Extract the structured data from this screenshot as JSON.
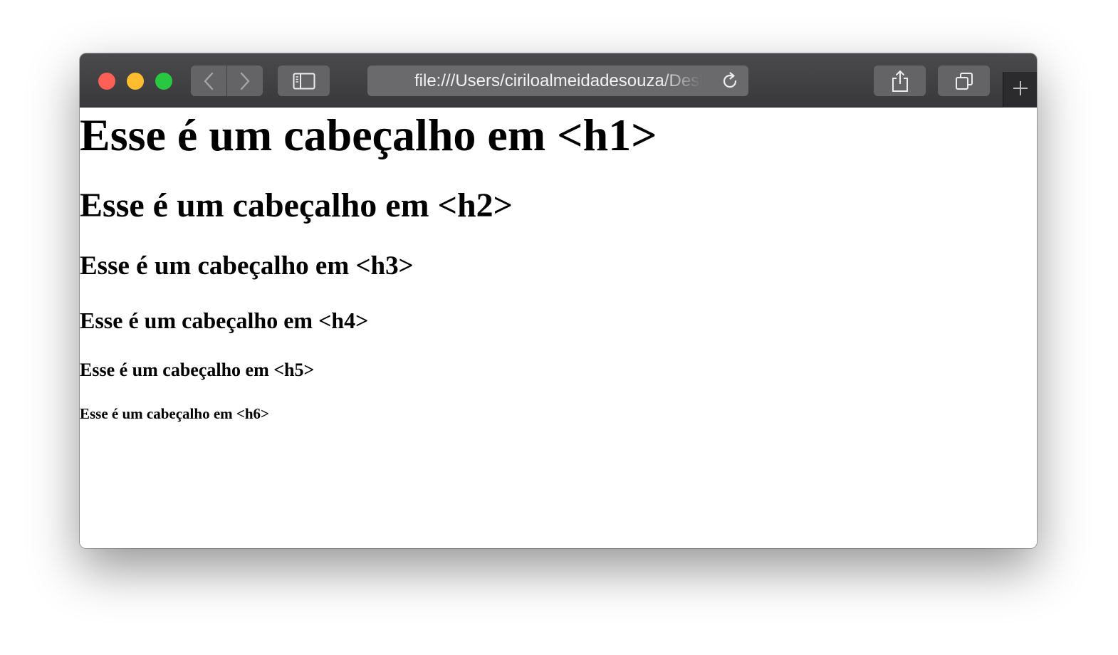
{
  "browser": {
    "address": "file:///Users/ciriloalmeidadesouza/Desktop/index.html",
    "icons": {
      "back": "chevron-left-icon",
      "forward": "chevron-right-icon",
      "sidebar": "sidebar-icon",
      "reload": "reload-icon",
      "share": "share-icon",
      "tabs": "tabs-overview-icon",
      "new_tab": "plus-icon"
    },
    "colors": {
      "close": "#fe5f57",
      "minimize": "#febc2e",
      "zoom": "#28c840",
      "toolbar": "#3f3f41"
    }
  },
  "page": {
    "h1": "Esse é um cabeçalho em <h1>",
    "h2": "Esse é um cabeçalho em <h2>",
    "h3": "Esse é um cabeçalho em <h3>",
    "h4": "Esse é um cabeçalho em <h4>",
    "h5": "Esse é um cabeçalho em <h5>",
    "h6": "Esse é um cabeçalho em <h6>"
  }
}
